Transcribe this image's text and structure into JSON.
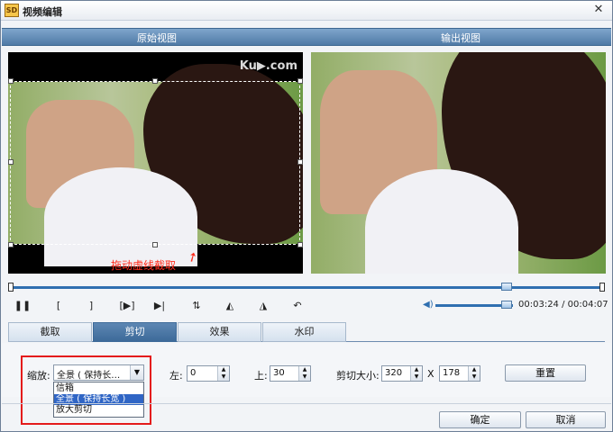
{
  "window": {
    "title": "视频编辑",
    "app_icon_text": "SD"
  },
  "header": {
    "source_view": "原始视图",
    "output_view": "输出视图"
  },
  "preview": {
    "logo": "Ku▶.com",
    "drag_hint": "拖动虚线截取"
  },
  "playback": {
    "current_time": "00:03:24",
    "total_time": "00:04:07",
    "time_separator": " / ",
    "progress_fraction": 0.826,
    "volume_fraction": 0.92,
    "controls": [
      {
        "name": "pause-button",
        "glyph": "❚❚"
      },
      {
        "name": "mark-in-button",
        "glyph": "["
      },
      {
        "name": "mark-out-button",
        "glyph": "]"
      },
      {
        "name": "play-selection-button",
        "glyph": "[▶]"
      },
      {
        "name": "next-frame-button",
        "glyph": "▶|"
      },
      {
        "name": "flip-vertical-button",
        "glyph": "⇅"
      },
      {
        "name": "rotate-left-button",
        "glyph": "◭"
      },
      {
        "name": "rotate-right-button",
        "glyph": "◮"
      },
      {
        "name": "undo-button",
        "glyph": "↶"
      }
    ]
  },
  "tabs": [
    {
      "label": "截取",
      "active": false
    },
    {
      "label": "剪切",
      "active": true
    },
    {
      "label": "效果",
      "active": false
    },
    {
      "label": "水印",
      "active": false
    }
  ],
  "crop_panel": {
    "zoom_label": "缩放:",
    "zoom_value": "全景 ( 保持长…",
    "zoom_options": [
      {
        "label": "信箱",
        "selected": false
      },
      {
        "label": "全景 ( 保持长宽 )",
        "selected": true
      },
      {
        "label": "放大剪切",
        "selected": false
      }
    ],
    "left_label": "左:",
    "left_value": "0",
    "top_label": "上:",
    "top_value": "30",
    "crop_size_label": "剪切大小:",
    "crop_width": "320",
    "size_separator": "X",
    "crop_height": "178",
    "reset_label": "重置"
  },
  "footer": {
    "ok_label": "确定",
    "cancel_label": "取消"
  },
  "colors": {
    "accent": "#4f7aa6",
    "highlight": "#e41b1b",
    "hint": "#ff2b1a",
    "selection": "#2f65c5"
  }
}
